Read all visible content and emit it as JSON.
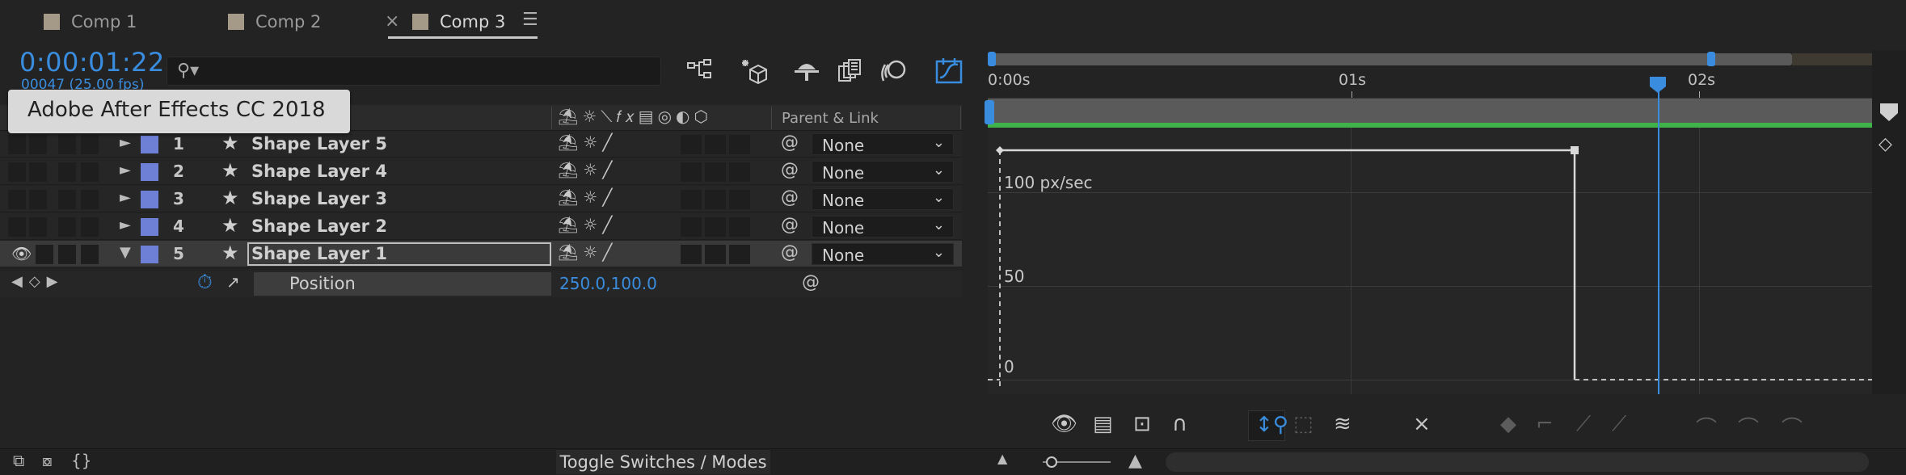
{
  "tabs": [
    {
      "label": "Comp 1"
    },
    {
      "label": "Comp 2"
    },
    {
      "label": "Comp 3"
    }
  ],
  "timecode": "0:00:01:22",
  "frames": "00047 (25.00 fps)",
  "tooltip": "Adobe After Effects CC 2018",
  "columns": {
    "parent_link": "Parent & Link"
  },
  "layers": [
    {
      "num": "1",
      "name": "Shape Layer 5",
      "parent": "None"
    },
    {
      "num": "2",
      "name": "Shape Layer 4",
      "parent": "None"
    },
    {
      "num": "3",
      "name": "Shape Layer 3",
      "parent": "None"
    },
    {
      "num": "4",
      "name": "Shape Layer 2",
      "parent": "None"
    },
    {
      "num": "5",
      "name": "Shape Layer 1",
      "parent": "None"
    }
  ],
  "property": {
    "name": "Position",
    "value": "250.0,100.0"
  },
  "ruler": {
    "labels": [
      "0:00s",
      "01s",
      "02s"
    ]
  },
  "graph": {
    "speed_label": "100 px/sec",
    "mid_label": "50",
    "zero_label": "0"
  },
  "bottom": {
    "toggle_label": "Toggle Switches / Modes"
  },
  "colors": {
    "accent": "#3a8dde",
    "label": "#6e7fd6",
    "workarea": "#3fb24a"
  }
}
